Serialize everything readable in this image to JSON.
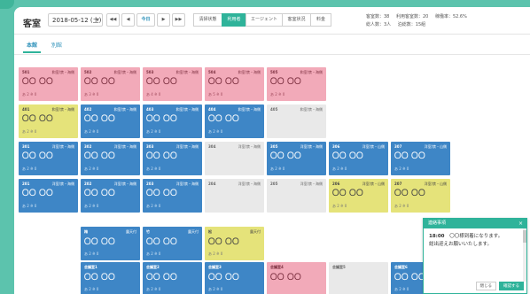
{
  "header": {
    "brand": "客室",
    "date": "2018-05-12 (土)",
    "nav": {
      "first": "◀◀",
      "prev": "◀",
      "today": "今日",
      "next": "▶",
      "last": "▶▶"
    },
    "modes": [
      "清掃状態",
      "利用者",
      "エージェント",
      "客室状況",
      "料金"
    ],
    "active_mode": 1,
    "stats": {
      "row1": [
        "客室数：38",
        "利用客室数：20",
        "稼働率：52.6%"
      ],
      "row2": [
        "総人数：3人",
        "泊総数：15組"
      ]
    }
  },
  "subtabs": [
    "本館",
    "別館"
  ],
  "rooms": [
    {
      "num": "501",
      "tag": "和室/禁・海側",
      "name": "〇〇 〇〇",
      "sub": "あ 2 ※ 0",
      "color": "pink"
    },
    {
      "num": "502",
      "tag": "和室/禁・海側",
      "name": "〇〇 〇〇",
      "sub": "あ 3 ※ 0",
      "color": "pink"
    },
    {
      "num": "503",
      "tag": "和室/禁・海側",
      "name": "〇〇 〇〇",
      "sub": "あ 4 ※ 0",
      "color": "pink"
    },
    {
      "num": "504",
      "tag": "和室/禁・海側",
      "name": "〇〇 〇〇",
      "sub": "あ 5 ※ 0",
      "color": "pink"
    },
    {
      "num": "505",
      "tag": "和室/禁・海側",
      "name": "〇〇 〇〇",
      "sub": "あ 2 ※ 0",
      "color": "pink"
    },
    {
      "num": "401",
      "tag": "和室/禁・海側",
      "name": "〇〇 〇〇",
      "sub": "あ 2 ※ 0",
      "color": "yellow"
    },
    {
      "num": "402",
      "tag": "和室/禁・海側",
      "name": "〇〇 〇〇",
      "sub": "あ 2 ※ 0",
      "color": "blue"
    },
    {
      "num": "403",
      "tag": "和室/禁・海側",
      "name": "〇〇 〇〇",
      "sub": "あ 2 ※ 0",
      "color": "blue"
    },
    {
      "num": "404",
      "tag": "和室/禁・海側",
      "name": "〇〇 〇〇",
      "sub": "あ 2 ※ 0",
      "color": "blue"
    },
    {
      "num": "405",
      "tag": "和室/禁・海側",
      "name": "",
      "sub": "",
      "color": "gray"
    },
    {
      "num": "301",
      "tag": "洋室/禁・海側",
      "name": "〇〇 〇〇",
      "sub": "あ 2 ※ 0",
      "color": "blue"
    },
    {
      "num": "302",
      "tag": "洋室/禁・海側",
      "name": "〇〇 〇〇",
      "sub": "あ 2 ※ 0",
      "color": "blue"
    },
    {
      "num": "303",
      "tag": "洋室/禁・海側",
      "name": "〇〇 〇〇",
      "sub": "あ 2 ※ 0",
      "color": "blue"
    },
    {
      "num": "304",
      "tag": "洋室/禁・海側",
      "name": "",
      "sub": "",
      "color": "gray"
    },
    {
      "num": "305",
      "tag": "洋室/禁・海側",
      "name": "〇〇 〇〇",
      "sub": "あ 2 ※ 0",
      "color": "blue"
    },
    {
      "num": "306",
      "tag": "洋室/禁・山側",
      "name": "〇〇 〇〇",
      "sub": "あ 2 ※ 0",
      "color": "blue"
    },
    {
      "num": "307",
      "tag": "洋室/禁・山側",
      "name": "〇〇 〇〇",
      "sub": "あ 2 ※ 0",
      "color": "blue"
    },
    {
      "num": "201",
      "tag": "洋室/禁・海側",
      "name": "〇〇 〇〇",
      "sub": "あ 2 ※ 0",
      "color": "blue"
    },
    {
      "num": "202",
      "tag": "洋室/禁・海側",
      "name": "〇〇 〇〇",
      "sub": "あ 2 ※ 0",
      "color": "blue"
    },
    {
      "num": "203",
      "tag": "洋室/禁・海側",
      "name": "〇〇 〇〇",
      "sub": "あ 2 ※ 0",
      "color": "blue"
    },
    {
      "num": "204",
      "tag": "洋室/禁・海側",
      "name": "",
      "sub": "",
      "color": "gray"
    },
    {
      "num": "205",
      "tag": "洋室/禁・海側",
      "name": "",
      "sub": "",
      "color": "gray"
    },
    {
      "num": "206",
      "tag": "洋室/禁・山側",
      "name": "〇〇 〇〇",
      "sub": "あ 2 ※ 0",
      "color": "yellow"
    },
    {
      "num": "207",
      "tag": "洋室/禁・山側",
      "name": "〇〇 〇〇",
      "sub": "あ 2 ※ 0",
      "color": "yellow"
    },
    {
      "num": "梅",
      "tag": "露天付",
      "name": "〇〇 〇〇",
      "sub": "あ 2 ※ 0",
      "color": "blue"
    },
    {
      "num": "竹",
      "tag": "露天付",
      "name": "〇〇 〇〇",
      "sub": "あ 2 ※ 0",
      "color": "blue"
    },
    {
      "num": "松",
      "tag": "露天付",
      "name": "〇〇 〇〇",
      "sub": "あ 2 ※ 0",
      "color": "yellow"
    },
    {
      "num": "会議室1",
      "tag": "",
      "name": "〇〇 〇〇",
      "sub": "あ 2 ※ 0",
      "color": "blue"
    },
    {
      "num": "会議室2",
      "tag": "",
      "name": "〇〇 〇〇",
      "sub": "あ 2 ※ 0",
      "color": "blue"
    },
    {
      "num": "会議室3",
      "tag": "",
      "name": "〇〇 〇〇",
      "sub": "あ 2 ※ 0",
      "color": "blue"
    },
    {
      "num": "会議室4",
      "tag": "",
      "name": "〇〇 〇〇",
      "sub": "",
      "color": "pink"
    },
    {
      "num": "会議室5",
      "tag": "",
      "name": "",
      "sub": "",
      "color": "gray"
    },
    {
      "num": "会議室6",
      "tag": "",
      "name": "〇〇 〇〇",
      "sub": "あ 2 ※ 0",
      "color": "blue"
    }
  ],
  "notification": {
    "title": "連絡事項",
    "close": "×",
    "time": "18:00",
    "line1": "〇〇様到着になります。",
    "line2": "総出迎えお願いいたします。",
    "btn_close": "閉じる",
    "btn_confirm": "確認する"
  }
}
